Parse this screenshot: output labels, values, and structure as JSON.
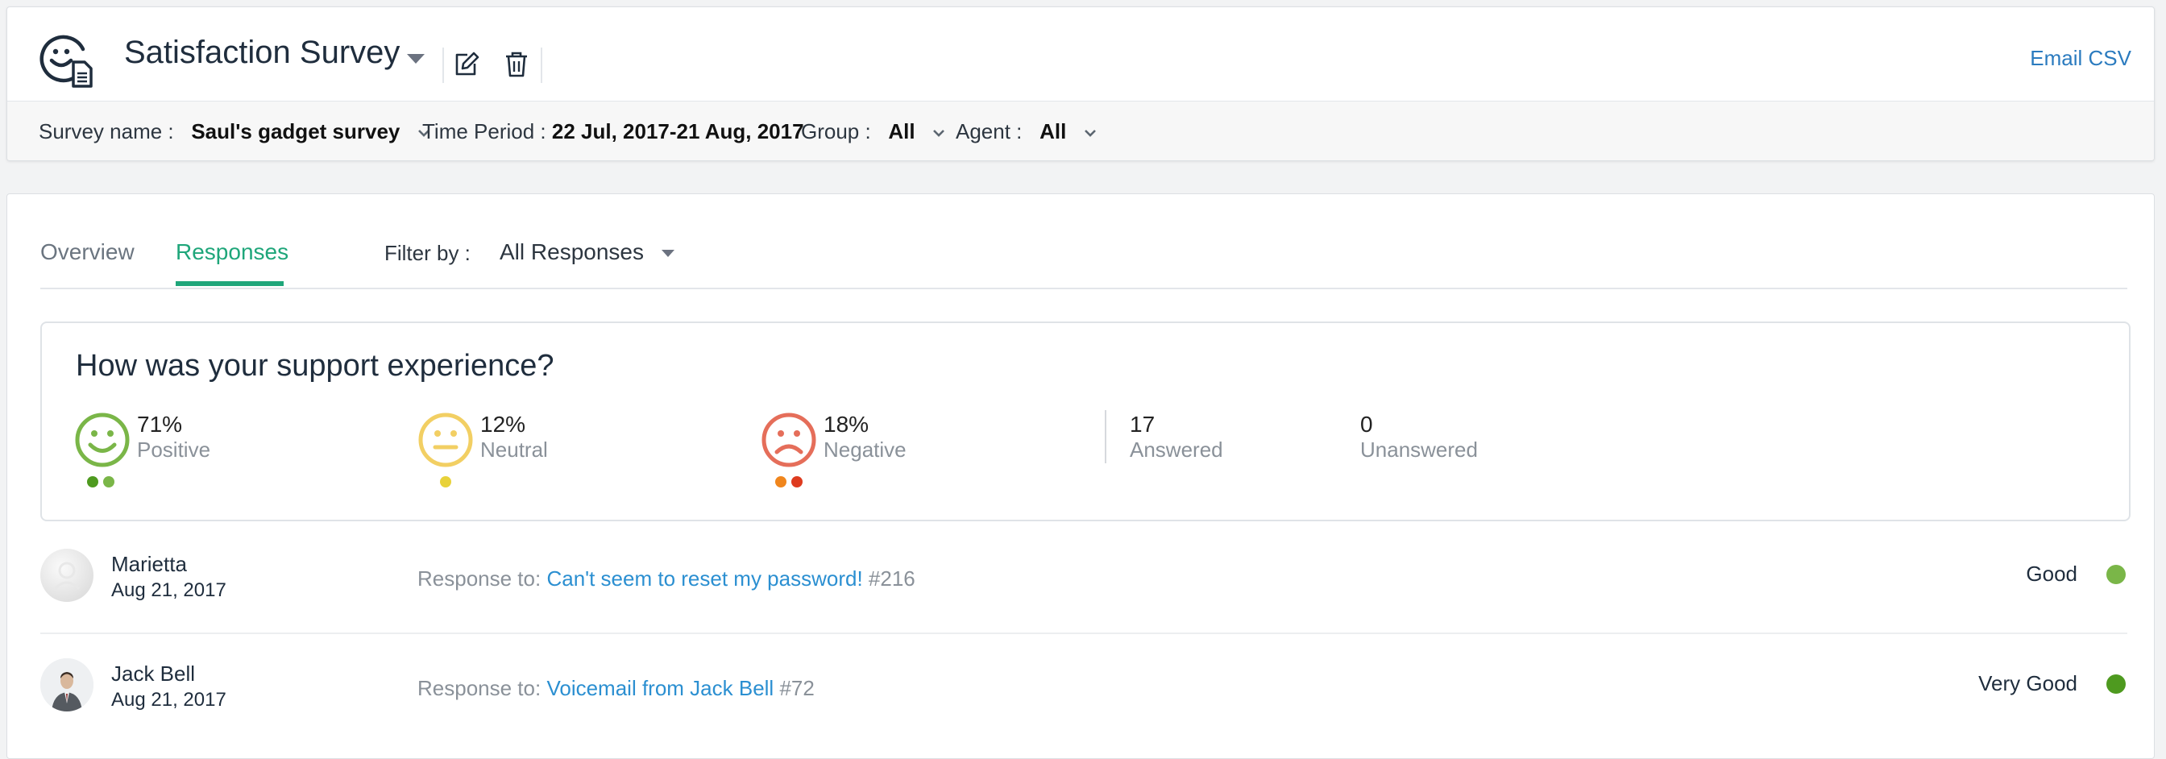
{
  "header": {
    "survey_title": "Satisfaction Survey",
    "email_csv": "Email CSV",
    "icons": {
      "app": "survey-smiley-icon",
      "edit": "edit-icon",
      "delete": "trash-icon"
    }
  },
  "filters": {
    "survey_name_label": "Survey name :",
    "survey_name_value": "Saul's gadget survey",
    "time_period_label": "Time Period :",
    "time_period_value": "22 Jul, 2017-21 Aug, 2017",
    "group_label": "Group :",
    "group_value": "All",
    "agent_label": "Agent :",
    "agent_value": "All"
  },
  "tabs": {
    "overview": "Overview",
    "responses": "Responses",
    "active": "Responses",
    "filter_label": "Filter by :",
    "filter_value": "All Responses"
  },
  "summary": {
    "question": "How was your support experience?",
    "positive": {
      "pct": "71%",
      "label": "Positive"
    },
    "neutral": {
      "pct": "12%",
      "label": "Neutral"
    },
    "negative": {
      "pct": "18%",
      "label": "Negative"
    },
    "answered": {
      "count": "17",
      "label": "Answered"
    },
    "unanswered": {
      "count": "0",
      "label": "Unanswered"
    }
  },
  "responses": [
    {
      "name": "Marietta",
      "date": "Aug 21, 2017",
      "prefix": "Response to:",
      "ticket_title": "Can't seem to reset my password!",
      "ticket_id": "#216",
      "rating": "Good",
      "rating_color": "#7ab648"
    },
    {
      "name": "Jack Bell",
      "date": "Aug 21, 2017",
      "prefix": "Response to:",
      "ticket_title": "Voicemail from Jack Bell",
      "ticket_id": "#72",
      "rating": "Very Good",
      "rating_color": "#4e9a1f"
    }
  ],
  "colors": {
    "accent_green": "#1fa67a",
    "link_blue": "#2b7bbf",
    "positive": "#7ab648",
    "positive_dark": "#4e9a1f",
    "neutral": "#f2cf63",
    "neutral_dot": "#e8d23a",
    "negative": "#e56e5a",
    "negative_dot1": "#f0861d",
    "negative_dot2": "#de3b1f"
  }
}
